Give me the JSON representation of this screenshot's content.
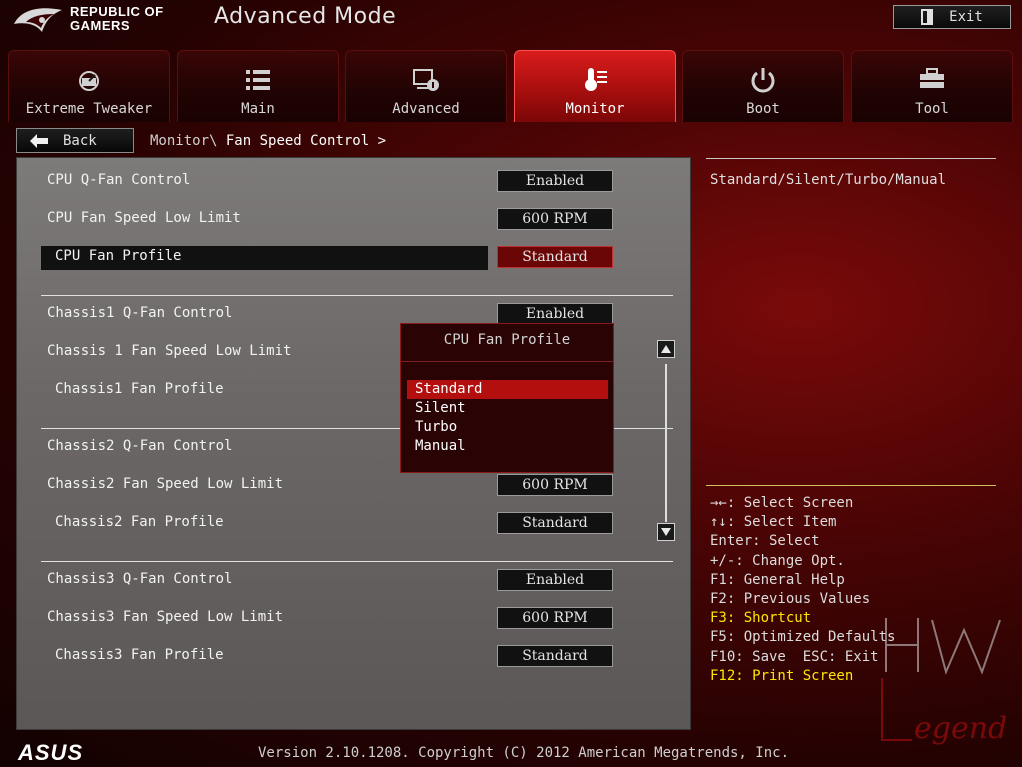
{
  "header": {
    "brand_line1": "REPUBLIC OF",
    "brand_line2": "GAMERS",
    "mode_title": "Advanced Mode",
    "exit_label": "Exit"
  },
  "tabs": [
    {
      "label": "Extreme Tweaker",
      "icon": "tweaker-icon"
    },
    {
      "label": "Main",
      "icon": "list-icon"
    },
    {
      "label": "Advanced",
      "icon": "advanced-icon"
    },
    {
      "label": "Monitor",
      "icon": "monitor-icon",
      "active": true
    },
    {
      "label": "Boot",
      "icon": "power-icon"
    },
    {
      "label": "Tool",
      "icon": "tool-icon"
    }
  ],
  "nav": {
    "back_label": "Back",
    "crumb_prefix": "Monitor\\",
    "crumb_current": "Fan Speed Control",
    "crumb_suffix": ">"
  },
  "settings": [
    {
      "label": "CPU Q-Fan Control",
      "value": "Enabled"
    },
    {
      "label": "CPU Fan Speed Low Limit",
      "value": "600 RPM"
    },
    {
      "label": "CPU Fan Profile",
      "value": "Standard",
      "selected": true
    },
    {
      "label": "Chassis1 Q-Fan Control",
      "value": "Enabled"
    },
    {
      "label": "Chassis 1 Fan Speed Low Limit",
      "value": ""
    },
    {
      "label": "Chassis1 Fan Profile",
      "value": ""
    },
    {
      "label": "Chassis2 Q-Fan Control",
      "value": ""
    },
    {
      "label": "Chassis2 Fan Speed Low Limit",
      "value": "600 RPM"
    },
    {
      "label": "Chassis2 Fan Profile",
      "value": "Standard"
    },
    {
      "label": "Chassis3 Q-Fan Control",
      "value": "Enabled"
    },
    {
      "label": "Chassis3 Fan Speed Low Limit",
      "value": "600 RPM"
    },
    {
      "label": "Chassis3 Fan Profile",
      "value": "Standard"
    }
  ],
  "popup": {
    "title": "CPU Fan Profile",
    "options": [
      "Standard",
      "Silent",
      "Turbo",
      "Manual"
    ],
    "selected_index": 0
  },
  "help": {
    "description": "Standard/Silent/Turbo/Manual",
    "keys": [
      {
        "text": "→←: Select Screen",
        "highlight": false
      },
      {
        "text": "↑↓: Select Item",
        "highlight": false
      },
      {
        "text": "Enter: Select",
        "highlight": false
      },
      {
        "text": "+/-: Change Opt.",
        "highlight": false
      },
      {
        "text": "F1: General Help",
        "highlight": false
      },
      {
        "text": "F2: Previous Values",
        "highlight": false
      },
      {
        "text": "F3: Shortcut",
        "highlight": true
      },
      {
        "text": "F5: Optimized Defaults",
        "highlight": false
      },
      {
        "text": "F10: Save  ESC: Exit",
        "highlight": false
      },
      {
        "text": "F12: Print Screen",
        "highlight": true
      }
    ]
  },
  "watermark": {
    "line1": "HW",
    "line2": "Legend"
  },
  "footer": {
    "brand": "ASUS",
    "version": "Version 2.10.1208. Copyright (C) 2012 American Megatrends, Inc."
  },
  "colors": {
    "accent_red": "#b30f0f",
    "active_tab": "#d91c1c",
    "highlight_yellow": "#ffe600"
  }
}
